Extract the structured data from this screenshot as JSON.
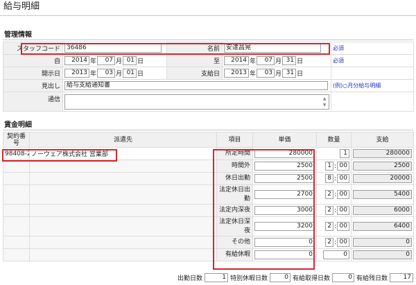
{
  "page": {
    "title": "給与明細"
  },
  "management": {
    "section_title": "管理情報",
    "staff_code_label": "スタッフコード",
    "staff_code": "36486",
    "name_label": "名前",
    "name": "安達昌晃",
    "required": "必須",
    "from_label": "自",
    "from": {
      "year": "2014",
      "month": "07",
      "day": "01"
    },
    "to_label": "至",
    "to": {
      "year": "2014",
      "month": "07",
      "day": "31"
    },
    "open_date_label": "開示日",
    "open_date": {
      "year": "2013",
      "month": "03",
      "day": "01"
    },
    "pay_date_label": "支給日",
    "pay_date": {
      "year": "2013",
      "month": "03",
      "day": "31"
    },
    "heading_label": "見出し",
    "heading_value": "給与支給通知書",
    "heading_example": "(例)○月分給与明細",
    "notes_label": "通信",
    "notes_value": "",
    "units": {
      "year": "年",
      "month": "月",
      "day": "日"
    }
  },
  "wage": {
    "section_title": "賃金明細",
    "headers": {
      "contract_no": "契約番号",
      "dispatch": "派遣先",
      "item": "項目",
      "unit_price": "単価",
      "quantity": "数量",
      "pay": "支給"
    },
    "contract_no": "98408-2",
    "dispatch": "ノーウェア株式会社 営業部",
    "rows": [
      {
        "item": "所定時間",
        "unit_price": "280000",
        "qty_h": "1",
        "qty_m": "",
        "pay": "280000"
      },
      {
        "item": "時間外",
        "unit_price": "2500",
        "qty_h": "1",
        "qty_m": "00",
        "pay": "2500"
      },
      {
        "item": "休日出勤",
        "unit_price": "2500",
        "qty_h": "8",
        "qty_m": "00",
        "pay": "20000"
      },
      {
        "item": "法定休日出勤",
        "unit_price": "2700",
        "qty_h": "2",
        "qty_m": "00",
        "pay": "5400"
      },
      {
        "item": "法定内深夜",
        "unit_price": "3000",
        "qty_h": "2",
        "qty_m": "00",
        "pay": "6000"
      },
      {
        "item": "法定休日深夜",
        "unit_price": "3200",
        "qty_h": "2",
        "qty_m": "00",
        "pay": "6400"
      },
      {
        "item": "その他",
        "unit_price": "0",
        "qty_h": "2",
        "qty_m": "00",
        "pay": "0"
      },
      {
        "item": "有給休暇",
        "unit_price": "0",
        "qty_h": "0",
        "qty_m": "",
        "pay": "0"
      }
    ],
    "footer": {
      "work_days_label": "出勤日数",
      "work_days": "1",
      "special_leave_label": "特別休暇日数",
      "special_leave": "0",
      "paid_leave_label": "有給取得日数",
      "paid_leave": "0",
      "paid_leave_remaining_label": "有給残日数",
      "paid_leave_remaining": "17"
    }
  }
}
